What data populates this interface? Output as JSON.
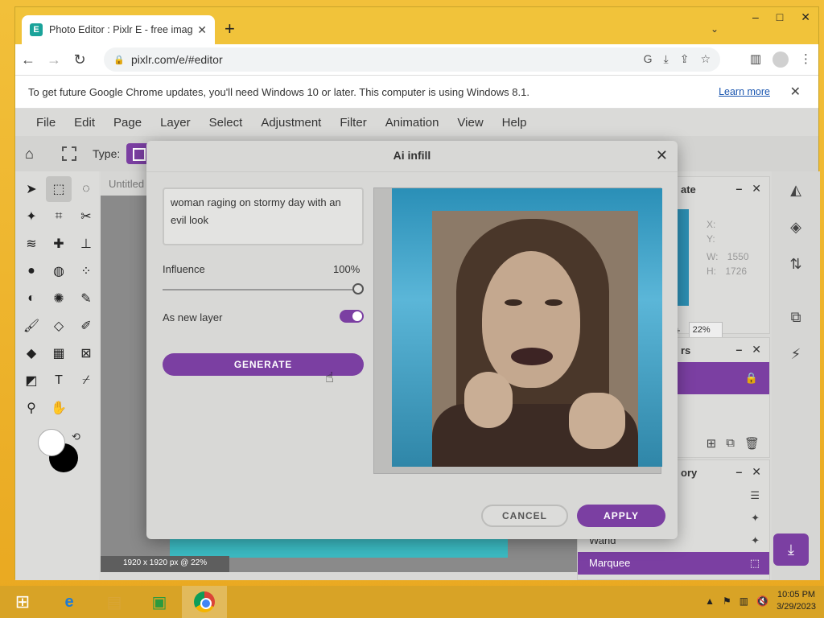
{
  "browser": {
    "tab_title": "Photo Editor : Pixlr E - free image",
    "favicon_letter": "E",
    "url": "pixlr.com/e/#editor",
    "window_controls": [
      "–",
      "□",
      "✕"
    ]
  },
  "infobar": {
    "message": "To get future Google Chrome updates, you'll need Windows 10 or later. This computer is using Windows 8.1.",
    "learn_more": "Learn more"
  },
  "app": {
    "menu": [
      "File",
      "Edit",
      "Page",
      "Layer",
      "Select",
      "Adjustment",
      "Filter",
      "Animation",
      "View",
      "Help"
    ],
    "type_label": "Type:",
    "canvas_tab": "Untitled",
    "canvas_status": "1920 x 1920 px @ 22%",
    "navigator": {
      "title": "ate",
      "x_label": "X:",
      "y_label": "Y:",
      "w_label": "W:",
      "w_value": "1550",
      "h_label": "H:",
      "h_value": "1726",
      "zoom": "22%"
    },
    "layers_title": "rs",
    "history": {
      "title": "ory",
      "items": [
        "",
        "",
        "Wand",
        "Marquee"
      ]
    }
  },
  "modal": {
    "title": "Ai infill",
    "prompt": "woman raging on stormy day with an evil look",
    "influence_label": "Influence",
    "influence_value": "100%",
    "influence": 1.0,
    "new_layer_label": "As new layer",
    "new_layer_on": true,
    "generate_label": "GENERATE",
    "cancel_label": "CANCEL",
    "apply_label": "APPLY"
  },
  "taskbar": {
    "time": "10:05 PM",
    "date": "3/29/2023"
  },
  "colors": {
    "accent": "#7b3fa2",
    "desktop": "#f1c33a"
  }
}
